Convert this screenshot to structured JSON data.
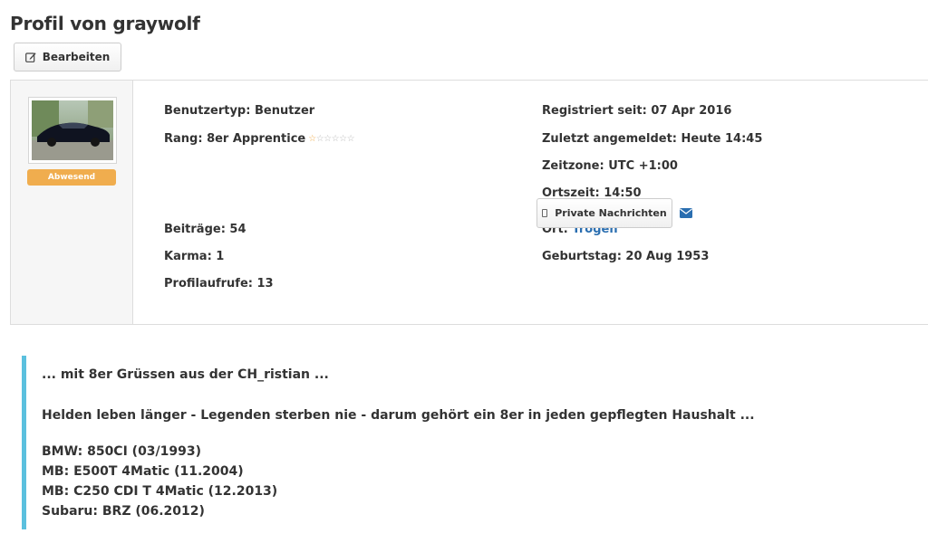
{
  "header": {
    "title": "Profil von graywolf",
    "edit_label": "Bearbeiten"
  },
  "profile": {
    "status": "Abwesend",
    "user_type": "Benutzertyp: Benutzer",
    "rank": "Rang: 8er Apprentice",
    "rank_stars": {
      "filled": 1,
      "total": 6
    },
    "posts": "Beiträge: 54",
    "karma": "Karma: 1",
    "views": "Profilaufrufe: 13",
    "registered": "Registriert seit: 07 Apr 2016",
    "last_login": "Zuletzt angemeldet: Heute 14:45",
    "timezone": "Zeitzone: UTC +1:00",
    "local_time": "Ortszeit: 14:50",
    "location_label": "Ort:",
    "location_value": "Trogen",
    "birthday": "Geburtstag: 20 Aug 1953",
    "pm_label": "Private Nachrichten"
  },
  "signature": {
    "line1": "... mit 8er Grüssen aus der CH_ristian ...",
    "line2": "Helden leben länger - Legenden sterben nie - darum gehört ein 8er in jeden gepflegten Haushalt ...",
    "cars": [
      "BMW: 850CI (03/1993)",
      "MB: E500T 4Matic (11.2004)",
      "MB: C250 CDI T 4Matic (12.2013)",
      "Subaru: BRZ (06.2012)"
    ]
  },
  "colors": {
    "accent_link": "#2a6eb0",
    "status_away": "#f0ad4e",
    "quote_border": "#5bc0de"
  },
  "icons": {
    "edit": "edit-icon",
    "pm": "pm-icon",
    "mail": "mail-icon",
    "star": "star-icon"
  }
}
